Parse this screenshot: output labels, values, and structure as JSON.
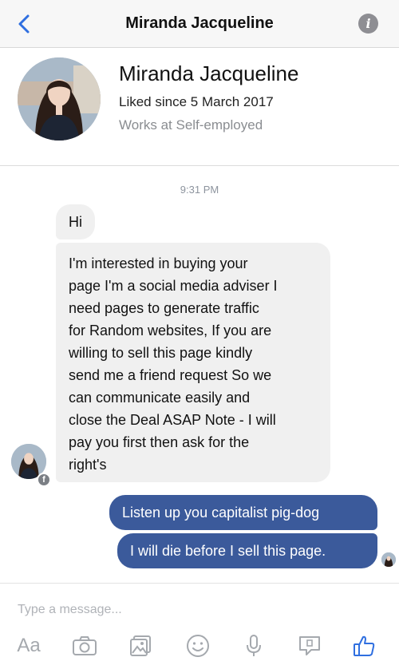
{
  "header": {
    "title": "Miranda Jacqueline"
  },
  "profile": {
    "name": "Miranda Jacqueline",
    "liked_since": "Liked since 5 March 2017",
    "works_at": "Works at Self-employed"
  },
  "conversation": {
    "timestamp": "9:31 PM",
    "incoming": [
      {
        "text": "Hi"
      },
      {
        "text": "I'm interested in buying your\npage I'm a social media adviser I\nneed pages to generate traffic\nfor  Random websites, If you are\nwilling to sell this page kindly\nsend me a friend request So we\ncan communicate easily and\nclose the Deal ASAP Note - I will\npay you first then ask for the\nright's"
      }
    ],
    "outgoing": [
      {
        "text": "Listen up you capitalist pig-dog"
      },
      {
        "text": "I will die before I sell this page."
      }
    ]
  },
  "composer": {
    "placeholder": "Type a message...",
    "aa_label": "Aa"
  },
  "colors": {
    "outgoing_bubble": "#3b5a9b",
    "incoming_bubble": "#f0f0f0",
    "accent": "#2f6fe0",
    "icon_gray": "#a5a9ae"
  },
  "icons": {
    "back": "chevron-left-icon",
    "info": "info-icon",
    "camera": "camera-icon",
    "gallery": "photo-icon",
    "emoji": "smiley-icon",
    "mic": "microphone-icon",
    "sticker": "sticker-icon",
    "like": "thumbs-up-icon"
  }
}
